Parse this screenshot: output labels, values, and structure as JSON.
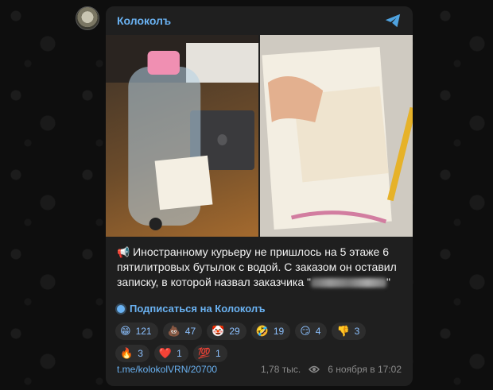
{
  "channel": {
    "name": "Колоколъ"
  },
  "post": {
    "caption_line_1": "Иностранному курьеру не пришлось на 5 этаже 6",
    "caption_line_2": "пятилитровых бутылок с водой. С заказом он оставил",
    "caption_line_3": "записку, в которой назвал заказчика \"",
    "caption_line_3_end": "\"",
    "subscribe_label": "Подписаться на Колоколъ",
    "reactions": [
      {
        "emoji": "😁",
        "count": "121"
      },
      {
        "emoji": "💩",
        "count": "47"
      },
      {
        "emoji": "🤡",
        "count": "29"
      },
      {
        "emoji": "🤣",
        "count": "19"
      },
      {
        "emoji": "😏",
        "count": "4"
      },
      {
        "emoji": "👎",
        "count": "3"
      },
      {
        "emoji": "🔥",
        "count": "3"
      },
      {
        "emoji": "❤️",
        "count": "1"
      },
      {
        "emoji": "💯",
        "count": "1"
      }
    ],
    "link": "t.me/kolokolVRN/20700",
    "views": "1,78 тыс.",
    "date": "6 ноября в 17:02"
  },
  "colors": {
    "accent": "#6ab2f2",
    "card_bg": "#1f1f1f",
    "page_bg": "#0e0e0e"
  },
  "icons": {
    "share": "share-arrow-icon",
    "views": "eye-icon"
  }
}
